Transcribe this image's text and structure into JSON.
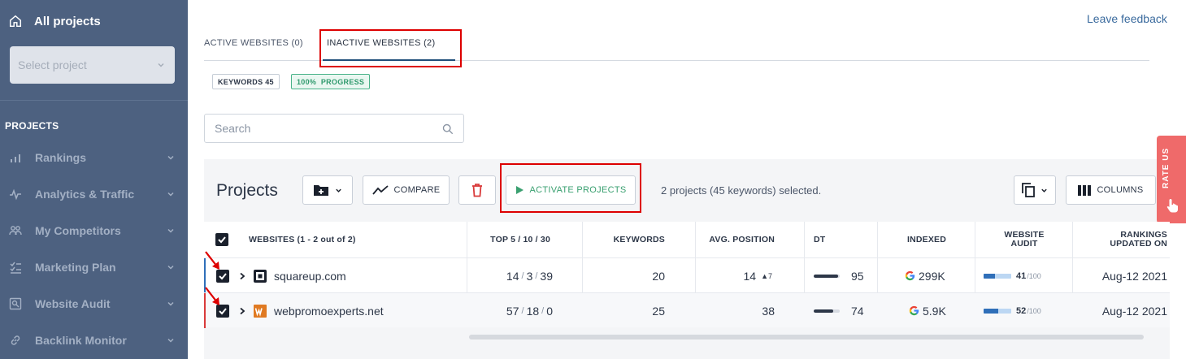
{
  "sidebar": {
    "all_projects": "All projects",
    "select_placeholder": "Select project",
    "heading": "PROJECTS",
    "items": [
      {
        "label": "Rankings",
        "icon": "bar-chart-icon"
      },
      {
        "label": "Analytics & Traffic",
        "icon": "pulse-icon"
      },
      {
        "label": "My Competitors",
        "icon": "users-icon"
      },
      {
        "label": "Marketing Plan",
        "icon": "checklist-icon"
      },
      {
        "label": "Website Audit",
        "icon": "audit-search-icon"
      },
      {
        "label": "Backlink Monitor",
        "icon": "link-icon"
      }
    ]
  },
  "header": {
    "leave_feedback": "Leave feedback"
  },
  "tabs": [
    {
      "label": "ACTIVE WEBSITES (0)"
    },
    {
      "label": "INACTIVE WEBSITES (2)"
    }
  ],
  "chips": {
    "keywords": "KEYWORDS 45",
    "progress": "100%  PROGRESS"
  },
  "search": {
    "placeholder": "Search"
  },
  "toolbar": {
    "title": "Projects",
    "compare": "COMPARE",
    "activate": "ACTIVATE PROJECTS",
    "selection_info": "2 projects (45 keywords) selected.",
    "columns": "COLUMNS"
  },
  "rate_us": "RATE US",
  "table": {
    "headers": {
      "websites": "WEBSITES (1 - 2 out of 2)",
      "top": "TOP 5 / 10 / 30",
      "keywords": "KEYWORDS",
      "avg_position": "AVG. POSITION",
      "dt": "DT",
      "indexed": "INDEXED",
      "website_audit_1": "WEBSITE",
      "website_audit_2": "AUDIT",
      "rankings_updated_1": "RANKINGS",
      "rankings_updated_2": "UPDATED ON"
    },
    "rows": [
      {
        "site": "squareup.com",
        "top5": "14",
        "top10": "3",
        "top30": "39",
        "keywords": "20",
        "avg_position": "14",
        "avg_delta": "▲7",
        "dt": "95",
        "dt_fill": 0.95,
        "indexed": "299K",
        "audit": "41",
        "audit_of": "/100",
        "audit_fill": 0.41,
        "updated": "Aug-12 2021",
        "accent": "#2f6fb9"
      },
      {
        "site": "webpromoexperts.net",
        "top5": "57",
        "top10": "18",
        "top30": "0",
        "keywords": "25",
        "avg_position": "38",
        "avg_delta": "",
        "dt": "74",
        "dt_fill": 0.74,
        "indexed": "5.9K",
        "audit": "52",
        "audit_of": "/100",
        "audit_fill": 0.52,
        "updated": "Aug-12 2021",
        "accent": "#d93b3b"
      }
    ]
  },
  "colors": {
    "sidebar_bg": "#4d6180",
    "accent_green": "#3aa070",
    "highlight_red": "#dd0000",
    "rate_us_bg": "#ef6a6a"
  }
}
